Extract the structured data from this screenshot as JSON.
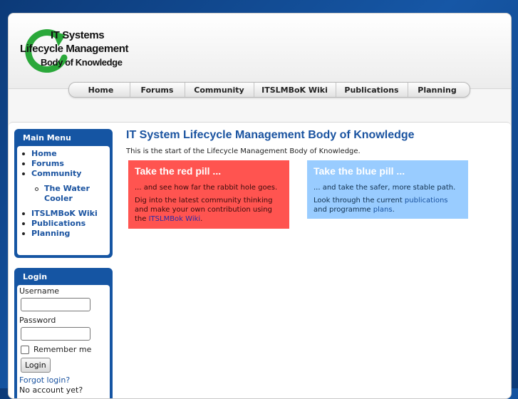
{
  "logo": {
    "line1": "IT Systems",
    "line2": "Lifecycle Management",
    "line3": "Body of Knowledge",
    "icon": "recycle-arrow-icon",
    "arrow_color": "#2aa83a"
  },
  "nav": {
    "items": [
      {
        "label": "Home"
      },
      {
        "label": "Forums"
      },
      {
        "label": "Community"
      },
      {
        "label": "ITSLMBoK Wiki"
      },
      {
        "label": "Publications"
      },
      {
        "label": "Planning"
      }
    ]
  },
  "main_menu": {
    "title": "Main Menu",
    "items": [
      {
        "label": "Home"
      },
      {
        "label": "Forums"
      },
      {
        "label": "Community"
      },
      {
        "label": "The Water Cooler"
      },
      {
        "label": "ITSLMBoK Wiki"
      },
      {
        "label": "Publications"
      },
      {
        "label": "Planning"
      }
    ]
  },
  "login": {
    "title": "Login",
    "username_label": "Username",
    "username_value": "",
    "password_label": "Password",
    "password_value": "",
    "remember_label": "Remember me",
    "button_label": "Login",
    "forgot_label": "Forgot login?",
    "no_account_label": "No account yet?"
  },
  "main": {
    "title": "IT System Lifecycle Management Body of Knowledge",
    "intro": "This is the start of the Lifecycle Management Body of Knowledge.",
    "red_pill": {
      "title": "Take the red pill ...",
      "line1": "... and see how far the rabbit hole goes.",
      "line2_pre": "Dig into the latest community thinking and make your own contribution using the ",
      "line2_link": "ITSLMBok Wiki",
      "line2_post": ".",
      "color": "#ff5450"
    },
    "blue_pill": {
      "title": "Take the blue pill ...",
      "line1": "... and take the safer, more stable path.",
      "line2_pre": "Look through the current ",
      "line2_link1": "publications",
      "line2_mid": " and programme ",
      "line2_link2": "plans",
      "line2_post": ".",
      "color": "#99ccff"
    }
  },
  "colors": {
    "accent_blue": "#1555a3",
    "link_blue": "#1a53a0"
  }
}
